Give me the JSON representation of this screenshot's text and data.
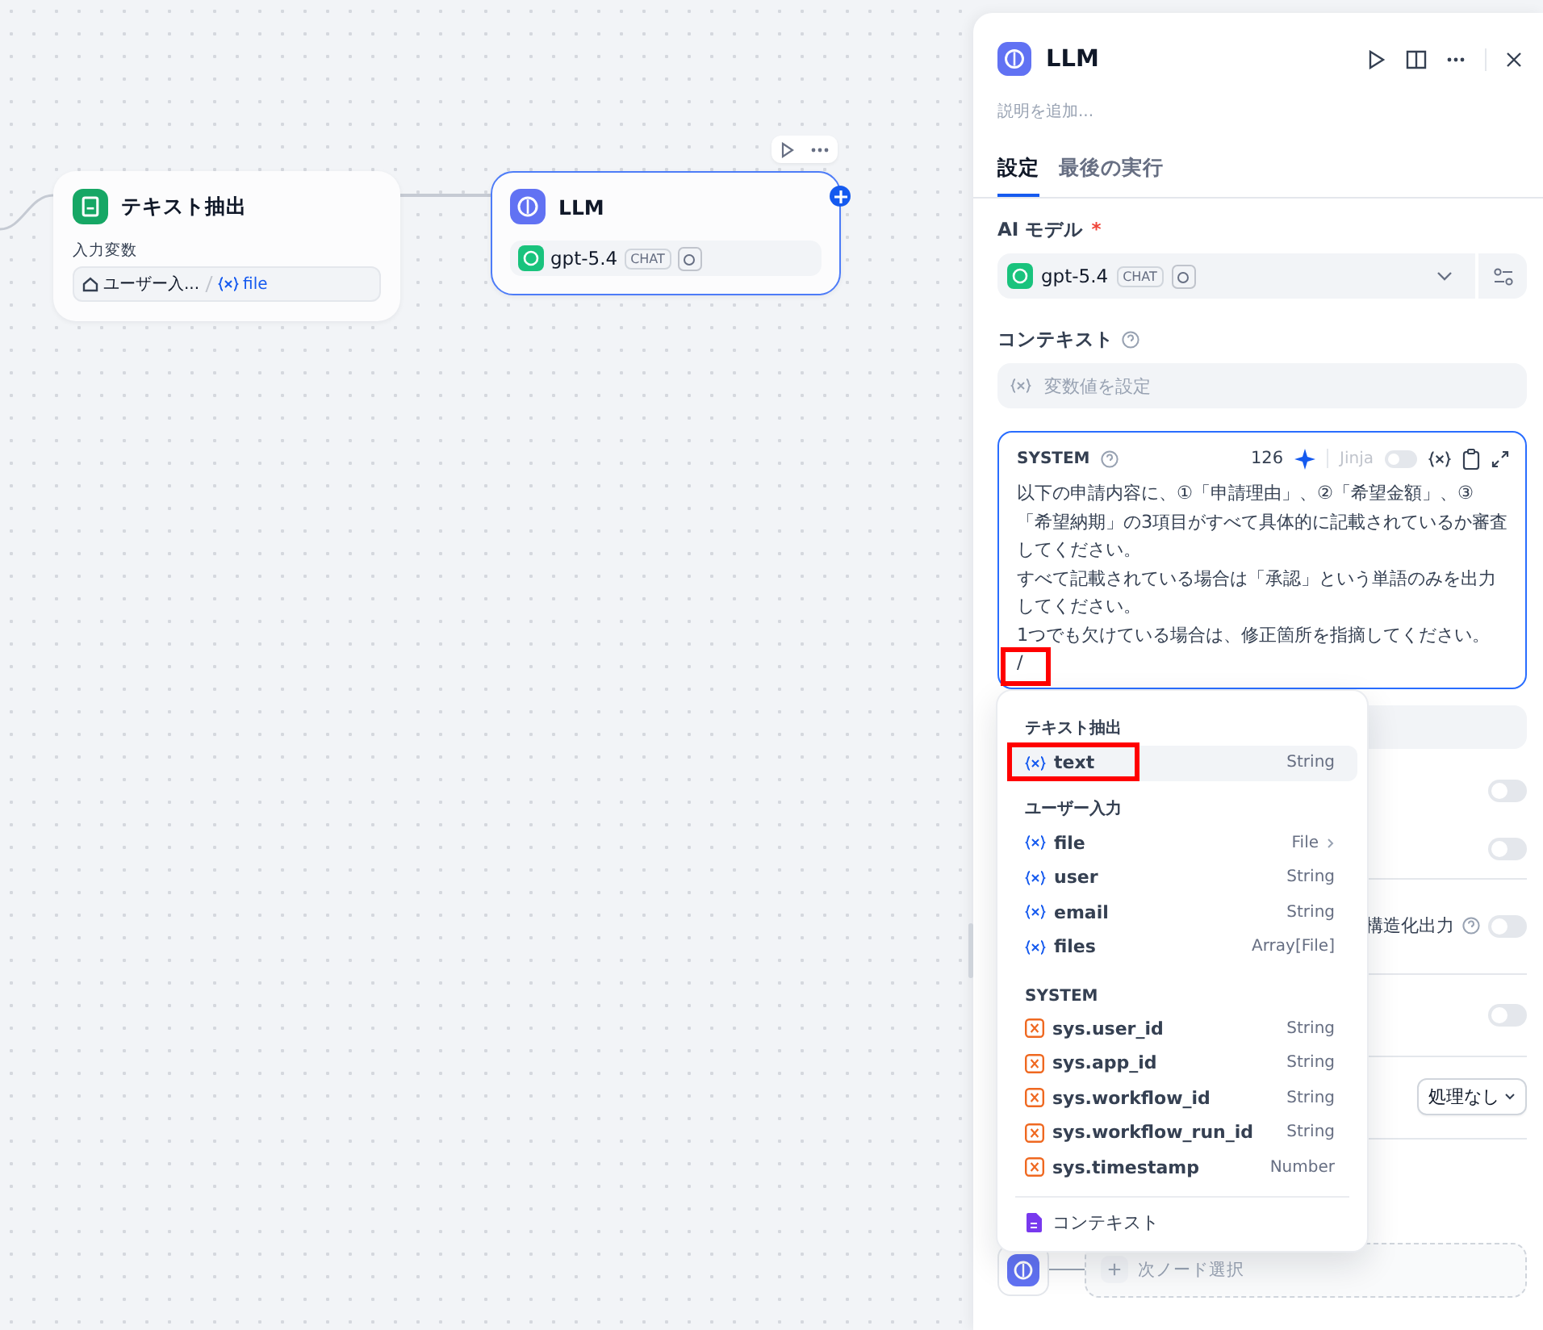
{
  "canvas": {
    "nodes": [
      {
        "kind": "extract",
        "title": "テキスト抽出",
        "input_label": "入力変数",
        "input_source": "ユーザー入...",
        "input_variable": "file",
        "selected": false
      },
      {
        "kind": "llm",
        "title": "LLM",
        "model": "gpt-5.4",
        "model_badge": "CHAT",
        "selected": true
      }
    ]
  },
  "panel": {
    "title": "LLM",
    "description_placeholder": "説明を追加...",
    "tabs": [
      {
        "label": "設定",
        "selected": true
      },
      {
        "label": "最後の実行",
        "selected": false
      }
    ],
    "model_label": "AI モデル",
    "model_required_mark": "*",
    "model": {
      "name": "gpt-5.4",
      "badge": "CHAT"
    },
    "context_label": "コンテキスト",
    "context_placeholder": "変数値を設定",
    "prompt": {
      "role": "SYSTEM",
      "count": "126",
      "jinja_label": "Jinja",
      "jinja_on": false,
      "focused": true,
      "cursor_annotated": true,
      "lines": [
        "以下の申請内容に、①「申請理由」、②「希望金額」、③「希望納期」の3項目がすべて具体的に記載されているか審査してください。",
        "すべて記載されている場合は「承認」という単語のみを出力してください。",
        "1つでも欠けている場合は、修正箇所を指摘してください。",
        "/"
      ]
    },
    "vision": {
      "on": false
    },
    "reasoning": {
      "on": false
    },
    "output": {
      "structured_label": "構造化出力",
      "structured_on": false
    },
    "retry": {
      "on": false
    },
    "error_handling": {
      "value": "処理なし"
    },
    "next_step": {
      "placeholder": "次ノード選択"
    }
  },
  "variable_menu": {
    "groups": [
      {
        "title": "テキスト抽出",
        "items": [
          {
            "kind": "node",
            "name": "text",
            "type": "String",
            "selected": true,
            "annotated": true,
            "has_submenu": false
          }
        ]
      },
      {
        "title": "ユーザー入力",
        "items": [
          {
            "kind": "node",
            "name": "file",
            "type": "File",
            "selected": false,
            "annotated": false,
            "has_submenu": true
          },
          {
            "kind": "node",
            "name": "user",
            "type": "String",
            "selected": false,
            "annotated": false,
            "has_submenu": false
          },
          {
            "kind": "node",
            "name": "email",
            "type": "String",
            "selected": false,
            "annotated": false,
            "has_submenu": false
          },
          {
            "kind": "node",
            "name": "files",
            "type": "Array[File]",
            "selected": false,
            "annotated": false,
            "has_submenu": false
          }
        ]
      },
      {
        "title": "SYSTEM",
        "items": [
          {
            "kind": "system",
            "name": "sys.user_id",
            "type": "String",
            "selected": false,
            "annotated": false,
            "has_submenu": false
          },
          {
            "kind": "system",
            "name": "sys.app_id",
            "type": "String",
            "selected": false,
            "annotated": false,
            "has_submenu": false
          },
          {
            "kind": "system",
            "name": "sys.workflow_id",
            "type": "String",
            "selected": false,
            "annotated": false,
            "has_submenu": false
          },
          {
            "kind": "system",
            "name": "sys.workflow_run_id",
            "type": "String",
            "selected": false,
            "annotated": false,
            "has_submenu": false
          },
          {
            "kind": "system",
            "name": "sys.timestamp",
            "type": "Number",
            "selected": false,
            "annotated": false,
            "has_submenu": false
          }
        ]
      }
    ],
    "footer": "コンテキスト"
  }
}
